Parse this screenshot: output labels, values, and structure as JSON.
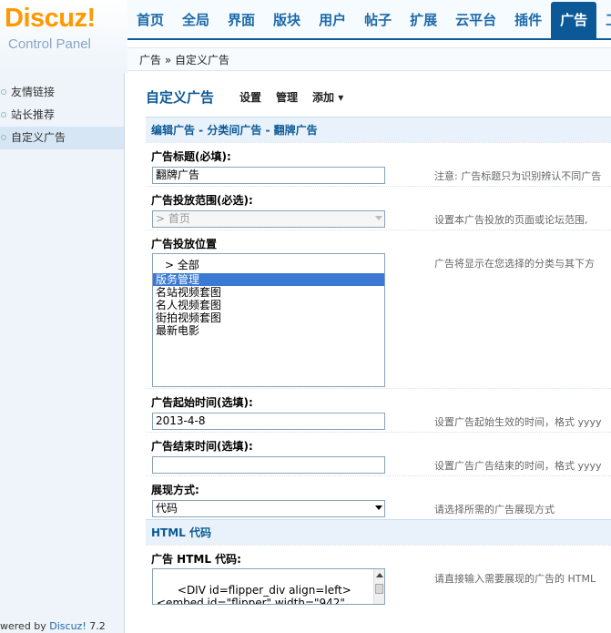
{
  "logo": {
    "brand": "Discuz!",
    "subtitle": "Control Panel"
  },
  "nav": {
    "tabs": [
      "首页",
      "全局",
      "界面",
      "版块",
      "用户",
      "帖子",
      "扩展",
      "云平台",
      "插件",
      "广告",
      "工"
    ],
    "active": "广告"
  },
  "breadcrumb": "广告 » 自定义广告",
  "sidebar": {
    "items": [
      {
        "label": "友情链接",
        "current": false
      },
      {
        "label": "站长推荐",
        "current": false
      },
      {
        "label": "自定义广告",
        "current": true
      }
    ],
    "footer_prefix": "wered by ",
    "footer_link": "Discuz!",
    "footer_version": " 7.2"
  },
  "page": {
    "title": "自定义广告",
    "actions": [
      "设置",
      "管理",
      "添加 ▾"
    ]
  },
  "section": {
    "heading": "编辑广告 - 分类间广告 - 翻牌广告"
  },
  "form": {
    "title_label": "广告标题(必填):",
    "title_value": "翻牌广告",
    "title_hint": "注意: 广告标题只为识别辨认不同广告",
    "scope_label": "广告投放范围(必选):",
    "scope_value": "> 首页",
    "scope_hint": "设置本广告投放的页面或论坛范围,",
    "position_label": "广告投放位置",
    "position_hint": "广告将显示在您选择的分类与其下方",
    "position_options": [
      "> 全部",
      "版务管理",
      "名站视频套图",
      "名人视频套图",
      "街拍视频套图",
      "最新电影"
    ],
    "position_selected": "版务管理",
    "start_label": "广告起始时间(选填):",
    "start_value": "2013-4-8",
    "start_hint": "设置广告起始生效的时间，格式 yyyy",
    "end_label": "广告结束时间(选填):",
    "end_value": "",
    "end_hint": "设置广告广告结束的时间，格式 yyyy",
    "mode_label": "展现方式:",
    "mode_value": "代码",
    "mode_hint": "请选择所需的广告展现方式",
    "html_section": "HTML 代码",
    "html_label": "广告 HTML 代码:",
    "html_value": "<DIV id=flipper_div align=left>\n<embed id=\"flipper\" width=\"942\"",
    "html_hint": "请直接输入需要展现的广告的 HTML"
  }
}
